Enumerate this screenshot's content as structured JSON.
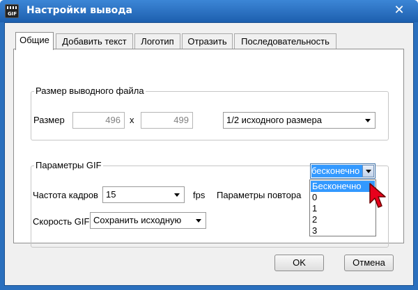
{
  "window": {
    "title": "Настройки вывода"
  },
  "tabs": [
    "Общие",
    "Добавить текст",
    "Логотип",
    "Отразить",
    "Последовательность"
  ],
  "output_size": {
    "group_title": "Размер выводного файла",
    "size_label": "Размер",
    "width": "496",
    "separator": "x",
    "height": "499",
    "scale_option": "1/2 исходного размера"
  },
  "gif_params": {
    "group_title": "Параметры GIF",
    "framerate_label": "Частота кадров",
    "framerate_value": "15",
    "fps_label": "fps",
    "repeat_label": "Параметры повтора",
    "repeat_value": "бесконечно",
    "speed_label": "Скорость GIF",
    "speed_value": "Сохранить исходную"
  },
  "repeat_dropdown": {
    "options": [
      "Бесконечно",
      "0",
      "1",
      "2",
      "3"
    ],
    "highlighted_index": 0
  },
  "buttons": {
    "ok": "OK",
    "cancel": "Отмена"
  },
  "icons": {
    "app": "gif-clapperboard-icon",
    "close": "close-icon",
    "cursor": "red-pointer-cursor-icon"
  },
  "colors": {
    "title_bar": "#2a6fbd",
    "selection": "#3399ff",
    "cursor": "#e8001c"
  }
}
